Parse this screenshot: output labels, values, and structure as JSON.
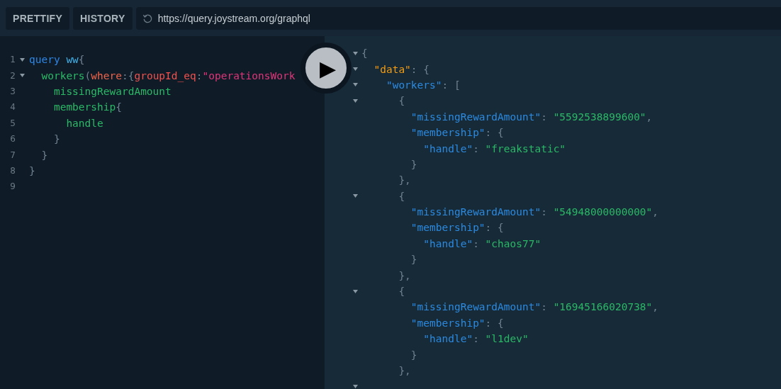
{
  "toolbar": {
    "buttons": [
      {
        "label": "PRETTIFY"
      },
      {
        "label": "HISTORY"
      }
    ],
    "url": "https://query.joystream.org/graphql"
  },
  "editor": {
    "lines": [
      {
        "number": "1",
        "foldable": true,
        "tokens": [
          {
            "text": "query ",
            "kind": "keyword"
          },
          {
            "text": "ww",
            "kind": "def"
          },
          {
            "text": "{",
            "kind": "punct"
          }
        ]
      },
      {
        "number": "2",
        "foldable": true,
        "tokens": [
          {
            "text": "  workers",
            "kind": "property"
          },
          {
            "text": "(",
            "kind": "punct"
          },
          {
            "text": "where",
            "kind": "attribute"
          },
          {
            "text": ":{",
            "kind": "punct"
          },
          {
            "text": "groupId_eq",
            "kind": "arg"
          },
          {
            "text": ":",
            "kind": "punct"
          },
          {
            "text": "\"operationsWork",
            "kind": "string"
          }
        ]
      },
      {
        "number": "3",
        "foldable": false,
        "tokens": [
          {
            "text": "    missingRewardAmount",
            "kind": "property"
          }
        ]
      },
      {
        "number": "4",
        "foldable": false,
        "tokens": [
          {
            "text": "    membership",
            "kind": "property"
          },
          {
            "text": "{",
            "kind": "punct"
          }
        ]
      },
      {
        "number": "5",
        "foldable": false,
        "tokens": [
          {
            "text": "      handle",
            "kind": "property"
          }
        ]
      },
      {
        "number": "6",
        "foldable": false,
        "tokens": [
          {
            "text": "    }",
            "kind": "punct"
          }
        ]
      },
      {
        "number": "7",
        "foldable": false,
        "tokens": [
          {
            "text": "  }",
            "kind": "punct"
          }
        ]
      },
      {
        "number": "8",
        "foldable": false,
        "tokens": [
          {
            "text": "}",
            "kind": "punct"
          }
        ]
      },
      {
        "number": "9",
        "foldable": false
      }
    ]
  },
  "run_button": {
    "label": "▶"
  },
  "result": {
    "lines": [
      {
        "foldable": true,
        "tokens": [
          {
            "text": "{",
            "kind": "punct"
          }
        ]
      },
      {
        "foldable": true,
        "tokens": [
          {
            "text": "  \"data\"",
            "kind": "root"
          },
          {
            "text": ": {",
            "kind": "punct"
          }
        ]
      },
      {
        "foldable": true,
        "tokens": [
          {
            "text": "    \"workers\"",
            "kind": "key"
          },
          {
            "text": ": [",
            "kind": "punct"
          }
        ]
      },
      {
        "foldable": true,
        "tokens": [
          {
            "text": "      {",
            "kind": "punct"
          }
        ]
      },
      {
        "foldable": false,
        "tokens": [
          {
            "text": "        \"missingRewardAmount\"",
            "kind": "key"
          },
          {
            "text": ": ",
            "kind": "punct"
          },
          {
            "text": "\"5592538899600\"",
            "kind": "value"
          },
          {
            "text": ",",
            "kind": "punct"
          }
        ]
      },
      {
        "foldable": false,
        "tokens": [
          {
            "text": "        \"membership\"",
            "kind": "key"
          },
          {
            "text": ": {",
            "kind": "punct"
          }
        ]
      },
      {
        "foldable": false,
        "tokens": [
          {
            "text": "          \"handle\"",
            "kind": "key"
          },
          {
            "text": ": ",
            "kind": "punct"
          },
          {
            "text": "\"freakstatic\"",
            "kind": "value"
          }
        ]
      },
      {
        "foldable": false,
        "tokens": [
          {
            "text": "        }",
            "kind": "punct"
          }
        ]
      },
      {
        "foldable": false,
        "tokens": [
          {
            "text": "      },",
            "kind": "punct"
          }
        ]
      },
      {
        "foldable": true,
        "tokens": [
          {
            "text": "      {",
            "kind": "punct"
          }
        ]
      },
      {
        "foldable": false,
        "tokens": [
          {
            "text": "        \"missingRewardAmount\"",
            "kind": "key"
          },
          {
            "text": ": ",
            "kind": "punct"
          },
          {
            "text": "\"54948000000000\"",
            "kind": "value"
          },
          {
            "text": ",",
            "kind": "punct"
          }
        ]
      },
      {
        "foldable": false,
        "tokens": [
          {
            "text": "        \"membership\"",
            "kind": "key"
          },
          {
            "text": ": {",
            "kind": "punct"
          }
        ]
      },
      {
        "foldable": false,
        "tokens": [
          {
            "text": "          \"handle\"",
            "kind": "key"
          },
          {
            "text": ": ",
            "kind": "punct"
          },
          {
            "text": "\"chaos77\"",
            "kind": "value"
          }
        ]
      },
      {
        "foldable": false,
        "tokens": [
          {
            "text": "        }",
            "kind": "punct"
          }
        ]
      },
      {
        "foldable": false,
        "tokens": [
          {
            "text": "      },",
            "kind": "punct"
          }
        ]
      },
      {
        "foldable": true,
        "tokens": [
          {
            "text": "      {",
            "kind": "punct"
          }
        ]
      },
      {
        "foldable": false,
        "tokens": [
          {
            "text": "        \"missingRewardAmount\"",
            "kind": "key"
          },
          {
            "text": ": ",
            "kind": "punct"
          },
          {
            "text": "\"16945166020738\"",
            "kind": "value"
          },
          {
            "text": ",",
            "kind": "punct"
          }
        ]
      },
      {
        "foldable": false,
        "tokens": [
          {
            "text": "        \"membership\"",
            "kind": "key"
          },
          {
            "text": ": {",
            "kind": "punct"
          }
        ]
      },
      {
        "foldable": false,
        "tokens": [
          {
            "text": "          \"handle\"",
            "kind": "key"
          },
          {
            "text": ": ",
            "kind": "punct"
          },
          {
            "text": "\"l1dev\"",
            "kind": "value"
          }
        ]
      },
      {
        "foldable": false,
        "tokens": [
          {
            "text": "        }",
            "kind": "punct"
          }
        ]
      },
      {
        "foldable": false,
        "tokens": [
          {
            "text": "      },",
            "kind": "punct"
          }
        ]
      },
      {
        "foldable": true
      }
    ]
  }
}
